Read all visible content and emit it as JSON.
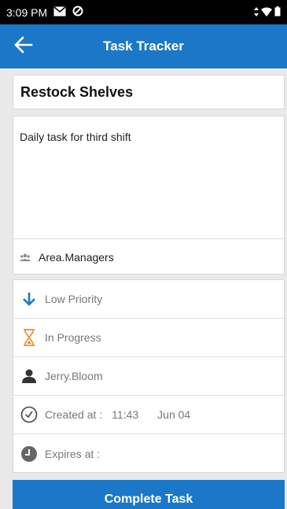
{
  "status_bar": {
    "time": "3:09 PM"
  },
  "app_bar": {
    "title": "Task Tracker"
  },
  "task": {
    "title": "Restock Shelves",
    "description": "Daily task for third shift",
    "group": "Area.Managers"
  },
  "details": {
    "priority": "Low Priority",
    "status": "In Progress",
    "assignee": "Jerry.Bloom",
    "created_label": "Created at :",
    "created_time": "11:43",
    "created_date": "Jun 04",
    "expires_label": "Expires at :"
  },
  "actions": {
    "complete_label": "Complete Task"
  },
  "colors": {
    "primary": "#1b78c8",
    "priority_icon": "#1b78c8",
    "status_icon": "#f28c28"
  },
  "icons": {
    "back": "arrow-left-icon",
    "group": "group-icon",
    "priority": "arrow-down-icon",
    "status": "hourglass-icon",
    "assignee": "person-icon",
    "created": "clock-icon",
    "expires": "clock-filled-icon"
  }
}
